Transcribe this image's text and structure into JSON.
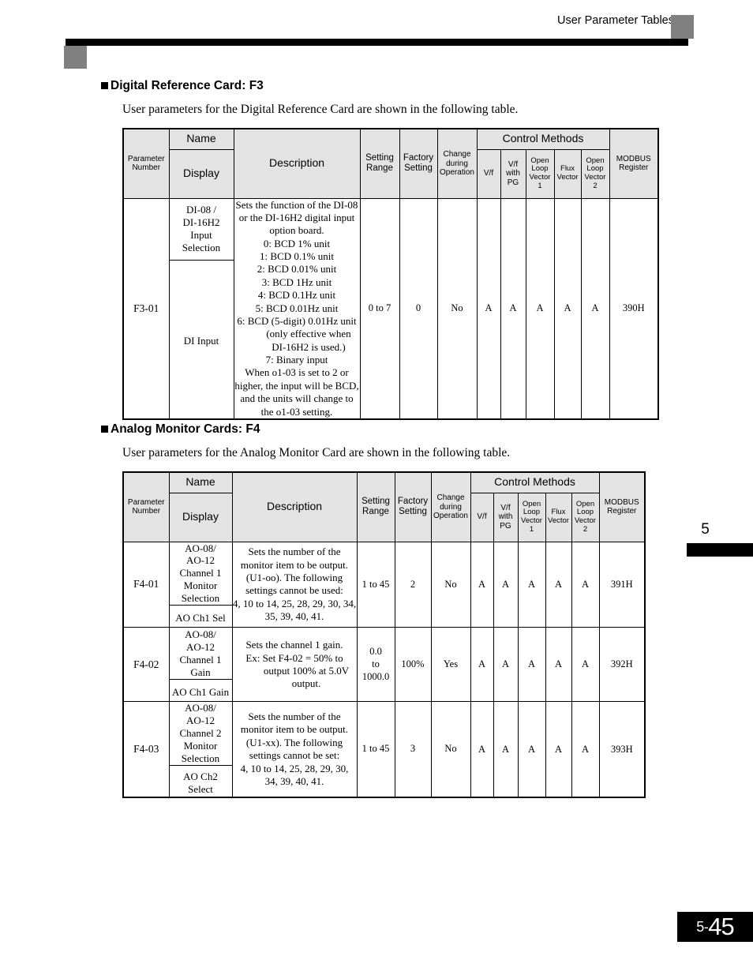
{
  "header": {
    "title": "User Parameter Tables"
  },
  "chapter": {
    "number": "5"
  },
  "footer": {
    "page_prefix": "5-",
    "page_number": "45"
  },
  "columns": {
    "parameter_number": "Parameter\nNumber",
    "parameter_number_l1": "Parameter",
    "parameter_number_l2": "Number",
    "name": "Name",
    "display": "Display",
    "description": "Description",
    "setting_range_l1": "Setting",
    "setting_range_l2": "Range",
    "factory_setting_l1": "Factory",
    "factory_setting_l2": "Setting",
    "change_during_operation_l1": "Change",
    "change_during_operation_l2": "during",
    "change_during_operation_l3": "Operation",
    "control_methods": "Control Methods",
    "vf": "V/f",
    "vf_with_pg_l1": "V/f",
    "vf_with_pg_l2": "with",
    "vf_with_pg_l3": "PG",
    "open_loop_vector_1_l1": "Open",
    "open_loop_vector_1_l2": "Loop",
    "open_loop_vector_1_l3": "Vector",
    "open_loop_vector_1_l4": "1",
    "flux_vector_l1": "Flux",
    "flux_vector_l2": "Vector",
    "open_loop_vector_2_l1": "Open",
    "open_loop_vector_2_l2": "Loop",
    "open_loop_vector_2_l3": "Vector",
    "open_loop_vector_2_l4": "2",
    "modbus_register_l1": "MODBUS",
    "modbus_register_l2": "Register"
  },
  "sections": [
    {
      "heading": "Digital Reference Card: F3",
      "intro": "User parameters for the Digital Reference Card are shown in the following table.",
      "rows": [
        {
          "parameter_number": "F3-01",
          "name_display_1": "DI-08 /\nDI-16H2\nInput\nSelection",
          "name_display_1_lines": [
            "DI-08 /",
            "DI-16H2",
            "Input",
            "Selection"
          ],
          "name_display_2": "DI Input",
          "description_lines": [
            "Sets the function of the DI-08",
            "or the DI-16H2 digital input",
            "option board.",
            " 0: BCD 1% unit",
            " 1: BCD 0.1% unit",
            " 2: BCD 0.01% unit",
            " 3: BCD 1Hz unit",
            " 4: BCD 0.1Hz unit",
            " 5: BCD 0.01Hz unit",
            " 6: BCD (5-digit) 0.01Hz unit",
            "(only effective when",
            "DI-16H2 is used.)",
            " 7: Binary input",
            "When o1-03 is set to 2 or",
            "higher, the input will be BCD,",
            "and the units will change to",
            "the o1-03 setting."
          ],
          "setting_range": "0 to 7",
          "factory_setting": "0",
          "change_during_operation": "No",
          "vf": "A",
          "vf_with_pg": "A",
          "open_loop_vector_1": "A",
          "flux_vector": "A",
          "open_loop_vector_2": "A",
          "modbus_register": "390H"
        }
      ]
    },
    {
      "heading": "Analog Monitor Cards: F4",
      "intro": "User parameters for the Analog Monitor Card are shown in the following table.",
      "rows": [
        {
          "parameter_number": "F4-01",
          "name_display_1_lines": [
            "AO-08/",
            "AO-12",
            "Channel 1",
            "Monitor",
            "Selection"
          ],
          "name_display_2": "AO Ch1 Sel",
          "description_lines": [
            "Sets the number of the",
            "monitor item to be output.",
            "(U1-oo). The following",
            "settings cannot be used:",
            "4, 10 to 14, 25, 28, 29, 30, 34,",
            "35, 39, 40, 41."
          ],
          "setting_range": "1 to 45",
          "factory_setting": "2",
          "change_during_operation": "No",
          "vf": "A",
          "vf_with_pg": "A",
          "open_loop_vector_1": "A",
          "flux_vector": "A",
          "open_loop_vector_2": "A",
          "modbus_register": "391H"
        },
        {
          "parameter_number": "F4-02",
          "name_display_1_lines": [
            "AO-08/",
            "AO-12",
            "Channel 1",
            "Gain"
          ],
          "name_display_2": "AO Ch1 Gain",
          "description_lines": [
            "Sets the channel 1 gain.",
            "Ex:   Set F4-02 = 50% to",
            "output 100% at 5.0V",
            "output."
          ],
          "setting_range": "0.0\nto\n1000.0",
          "setting_range_lines": [
            "0.0",
            "to",
            "1000.0"
          ],
          "factory_setting": "100%",
          "change_during_operation": "Yes",
          "vf": "A",
          "vf_with_pg": "A",
          "open_loop_vector_1": "A",
          "flux_vector": "A",
          "open_loop_vector_2": "A",
          "modbus_register": "392H"
        },
        {
          "parameter_number": "F4-03",
          "name_display_1_lines": [
            "AO-08/",
            "AO-12",
            "Channel 2",
            "Monitor",
            "Selection"
          ],
          "name_display_2": "AO Ch2\nSelect",
          "name_display_2_lines": [
            "AO Ch2",
            "Select"
          ],
          "description_lines": [
            "Sets the number of the",
            "monitor item to be output.",
            "(U1-xx). The following",
            "settings cannot be set:",
            "4, 10 to 14, 25, 28, 29, 30,",
            "34, 39, 40, 41."
          ],
          "setting_range": "1 to 45",
          "factory_setting": "3",
          "change_during_operation": "No",
          "vf": "A",
          "vf_with_pg": "A",
          "open_loop_vector_1": "A",
          "flux_vector": "A",
          "open_loop_vector_2": "A",
          "modbus_register": "393H"
        }
      ]
    }
  ]
}
